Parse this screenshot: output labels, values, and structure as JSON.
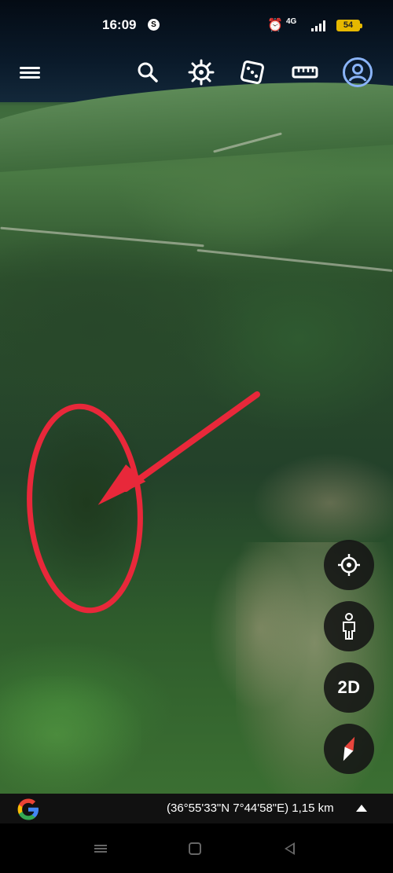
{
  "status_bar": {
    "time": "16:09",
    "notification_badge": "S",
    "network_label": "4G",
    "battery_level": "54",
    "icons": [
      "alarm-icon",
      "network-4g-icon",
      "signal-icon",
      "battery-icon"
    ]
  },
  "toolbar": {
    "buttons": [
      "menu-icon",
      "search-icon",
      "voyager-icon",
      "random-dice-icon",
      "measure-ruler-icon",
      "account-icon"
    ]
  },
  "map_controls": {
    "my_location": "my-location-icon",
    "pegman": "street-view-pegman-icon",
    "view_mode_label": "2D",
    "compass": "compass-icon"
  },
  "attribution_bar": {
    "logo": "google-logo",
    "coordinates": "(36°55'33\"N 7°44'58\"E) 1,15 km",
    "expand": "expand-up-icon"
  },
  "annotation": {
    "color": "#e8283a",
    "shapes": [
      "red-circle",
      "red-arrow"
    ]
  },
  "colors": {
    "control_bg": "#141414",
    "accent_blue": "#8ab4f8",
    "battery": "#e6b800"
  }
}
